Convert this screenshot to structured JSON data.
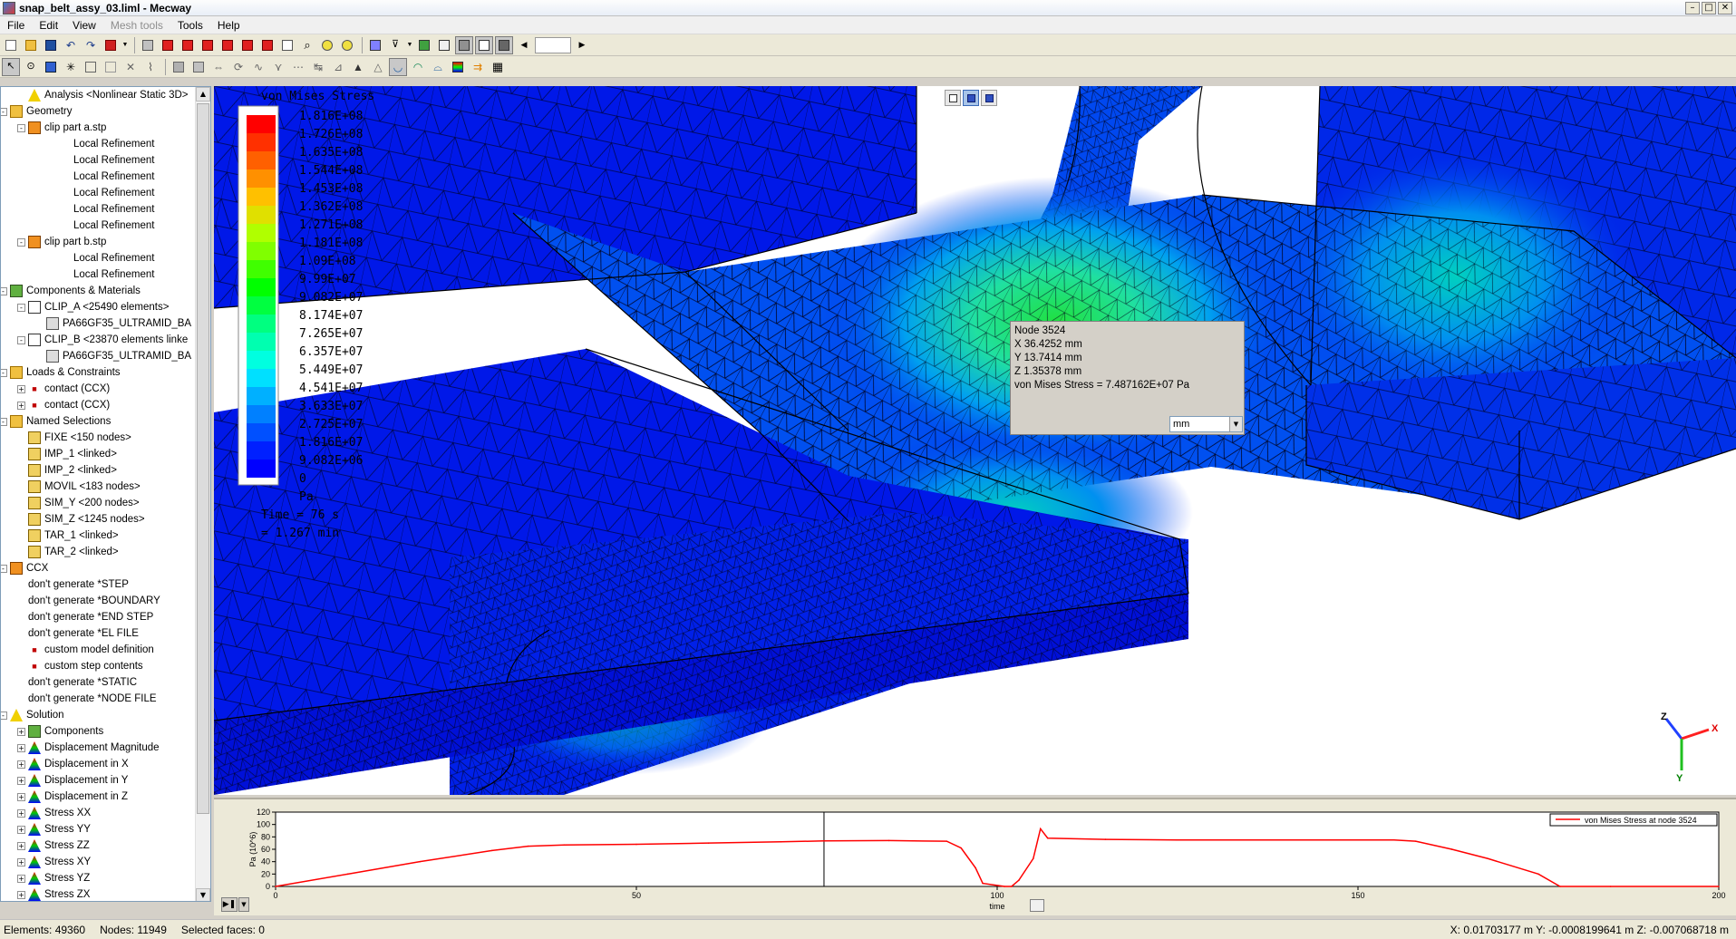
{
  "window": {
    "title": "snap_belt_assy_03.liml - Mecway",
    "min_btn": "–",
    "max_btn": "□",
    "close_btn": "✕"
  },
  "menu": [
    "File",
    "Edit",
    "View",
    "Mesh tools",
    "Tools",
    "Help"
  ],
  "tree": [
    {
      "label": "Analysis <Nonlinear Static 3D>",
      "level": 1,
      "icon": "analysis-icon",
      "expander": ""
    },
    {
      "label": "Geometry",
      "level": 0,
      "icon": "folder-icon",
      "expander": "-"
    },
    {
      "label": "clip part a.stp",
      "level": 1,
      "icon": "part-icon",
      "expander": "-"
    },
    {
      "label": "Local Refinement",
      "level": 3,
      "icon": "",
      "expander": ""
    },
    {
      "label": "Local Refinement",
      "level": 3,
      "icon": "",
      "expander": ""
    },
    {
      "label": "Local Refinement",
      "level": 3,
      "icon": "",
      "expander": ""
    },
    {
      "label": "Local Refinement",
      "level": 3,
      "icon": "",
      "expander": ""
    },
    {
      "label": "Local Refinement",
      "level": 3,
      "icon": "",
      "expander": ""
    },
    {
      "label": "Local Refinement",
      "level": 3,
      "icon": "",
      "expander": ""
    },
    {
      "label": "clip part b.stp",
      "level": 1,
      "icon": "part-icon",
      "expander": "-"
    },
    {
      "label": "Local Refinement",
      "level": 3,
      "icon": "",
      "expander": ""
    },
    {
      "label": "Local Refinement",
      "level": 3,
      "icon": "",
      "expander": ""
    },
    {
      "label": "Components & Materials",
      "level": 0,
      "icon": "components-icon",
      "expander": "-"
    },
    {
      "label": "CLIP_A <25490 elements>",
      "level": 1,
      "icon": "component-icon",
      "expander": "-"
    },
    {
      "label": "PA66GF35_ULTRAMID_BA",
      "level": 2,
      "icon": "material-icon",
      "expander": ""
    },
    {
      "label": "CLIP_B <23870 elements linke",
      "level": 1,
      "icon": "component-icon",
      "expander": "-"
    },
    {
      "label": "PA66GF35_ULTRAMID_BA",
      "level": 2,
      "icon": "material-icon",
      "expander": ""
    },
    {
      "label": "Loads & Constraints",
      "level": 0,
      "icon": "loads-icon",
      "expander": "-"
    },
    {
      "label": "contact (CCX)",
      "level": 1,
      "icon": "ccx-icon",
      "expander": "+"
    },
    {
      "label": "contact (CCX)",
      "level": 1,
      "icon": "ccx-icon",
      "expander": "+"
    },
    {
      "label": "Named Selections",
      "level": 0,
      "icon": "selection-folder-icon",
      "expander": "-"
    },
    {
      "label": "FIXE <150 nodes>",
      "level": 1,
      "icon": "selection-icon",
      "expander": ""
    },
    {
      "label": "IMP_1 <linked>",
      "level": 1,
      "icon": "selection-icon",
      "expander": ""
    },
    {
      "label": "IMP_2 <linked>",
      "level": 1,
      "icon": "selection-icon",
      "expander": ""
    },
    {
      "label": "MOVIL <183 nodes>",
      "level": 1,
      "icon": "selection-icon",
      "expander": ""
    },
    {
      "label": "SIM_Y <200 nodes>",
      "level": 1,
      "icon": "selection-icon",
      "expander": ""
    },
    {
      "label": "SIM_Z <1245 nodes>",
      "level": 1,
      "icon": "selection-icon",
      "expander": ""
    },
    {
      "label": "TAR_1 <linked>",
      "level": 1,
      "icon": "selection-icon",
      "expander": ""
    },
    {
      "label": "TAR_2 <linked>",
      "level": 1,
      "icon": "selection-icon",
      "expander": ""
    },
    {
      "label": "CCX",
      "level": 0,
      "icon": "ccx-folder-icon",
      "expander": "-"
    },
    {
      "label": "don't generate *STEP",
      "level": 1,
      "icon": "",
      "expander": ""
    },
    {
      "label": "don't generate *BOUNDARY",
      "level": 1,
      "icon": "",
      "expander": ""
    },
    {
      "label": "don't generate *END STEP",
      "level": 1,
      "icon": "",
      "expander": ""
    },
    {
      "label": "don't generate *EL FILE",
      "level": 1,
      "icon": "",
      "expander": ""
    },
    {
      "label": "custom model definition",
      "level": 1,
      "icon": "ccx-doc-icon",
      "expander": ""
    },
    {
      "label": "custom step contents",
      "level": 1,
      "icon": "ccx-doc-icon",
      "expander": ""
    },
    {
      "label": "don't generate *STATIC",
      "level": 1,
      "icon": "",
      "expander": ""
    },
    {
      "label": "don't generate *NODE FILE",
      "level": 1,
      "icon": "",
      "expander": ""
    },
    {
      "label": "Solution",
      "level": 0,
      "icon": "solution-icon",
      "expander": "-"
    },
    {
      "label": "Components",
      "level": 1,
      "icon": "components-icon",
      "expander": "+"
    },
    {
      "label": "Displacement Magnitude",
      "level": 1,
      "icon": "result-icon",
      "expander": "+"
    },
    {
      "label": "Displacement in X",
      "level": 1,
      "icon": "result-icon",
      "expander": "+"
    },
    {
      "label": "Displacement in Y",
      "level": 1,
      "icon": "result-icon",
      "expander": "+"
    },
    {
      "label": "Displacement in Z",
      "level": 1,
      "icon": "result-icon",
      "expander": "+"
    },
    {
      "label": "Stress XX",
      "level": 1,
      "icon": "result-icon",
      "expander": "+"
    },
    {
      "label": "Stress YY",
      "level": 1,
      "icon": "result-icon",
      "expander": "+"
    },
    {
      "label": "Stress ZZ",
      "level": 1,
      "icon": "result-icon",
      "expander": "+"
    },
    {
      "label": "Stress XY",
      "level": 1,
      "icon": "result-icon",
      "expander": "+"
    },
    {
      "label": "Stress YZ",
      "level": 1,
      "icon": "result-icon",
      "expander": "+"
    },
    {
      "label": "Stress ZX",
      "level": 1,
      "icon": "result-icon",
      "expander": "+"
    }
  ],
  "legend": {
    "title": "von Mises Stress",
    "values": [
      "1.816E+08",
      "1.726E+08",
      "1.635E+08",
      "1.544E+08",
      "1.453E+08",
      "1.362E+08",
      "1.271E+08",
      "1.181E+08",
      "1.09E+08",
      "9.99E+07",
      "9.082E+07",
      "8.174E+07",
      "7.265E+07",
      "6.357E+07",
      "5.449E+07",
      "4.541E+07",
      "3.633E+07",
      "2.725E+07",
      "1.816E+07",
      "9.082E+06",
      "0"
    ],
    "colors": [
      "#ff0000",
      "#ff3000",
      "#ff6000",
      "#ff9000",
      "#ffc000",
      "#e0e000",
      "#b0ff00",
      "#80ff00",
      "#40ff00",
      "#00ff00",
      "#00ff40",
      "#00ff80",
      "#00ffb0",
      "#00ffe0",
      "#00e0ff",
      "#00b0ff",
      "#0080ff",
      "#0050ff",
      "#0020ff",
      "#0000ff"
    ],
    "unit": "Pa",
    "time_s": "Time = 76 s",
    "time_min": "= 1.267 min"
  },
  "node_popup": {
    "node": "Node  3524",
    "x": "X  36.4252 mm",
    "y": "Y  13.7414 mm",
    "z": "Z  1.35378 mm",
    "stress": "von Mises Stress = 7.487162E+07 Pa",
    "unit": "mm"
  },
  "triad": {
    "x": "X",
    "y": "Y",
    "z": "Z"
  },
  "plot": {
    "ylabel": "Pa (10^6)",
    "xlabel": "time",
    "legend": "von Mises Stress at node 3524",
    "cursor_time": 76
  },
  "chart_data": {
    "type": "line",
    "title": "",
    "xlabel": "time",
    "ylabel": "Pa (10^6)",
    "xlim": [
      0,
      200
    ],
    "ylim": [
      0,
      120
    ],
    "xticks": [
      0,
      50,
      100,
      150,
      200
    ],
    "yticks": [
      0,
      20,
      40,
      60,
      80,
      100,
      120
    ],
    "series": [
      {
        "name": "von Mises Stress at node 3524",
        "color": "#ff0000",
        "x": [
          0,
          10,
          20,
          30,
          35,
          40,
          50,
          60,
          70,
          76,
          85,
          93,
          95,
          97,
          98,
          101,
          102,
          103,
          105,
          106,
          107,
          115,
          125,
          135,
          145,
          155,
          158,
          163,
          168,
          175,
          178,
          185,
          200
        ],
        "y": [
          0,
          20,
          40,
          58,
          65,
          67,
          68,
          70,
          72,
          73.5,
          74,
          73,
          62,
          30,
          5,
          0,
          0,
          10,
          45,
          93,
          78,
          76,
          75,
          75,
          75,
          75,
          73,
          60,
          45,
          20,
          0,
          0,
          0
        ]
      }
    ]
  },
  "statusbar": {
    "elements": "Elements: 49360",
    "nodes": "Nodes: 11949",
    "faces": "Selected faces: 0",
    "coords": "X: 0.01703177 m Y: -0.0008199641 m Z: -0.007068718 m"
  }
}
